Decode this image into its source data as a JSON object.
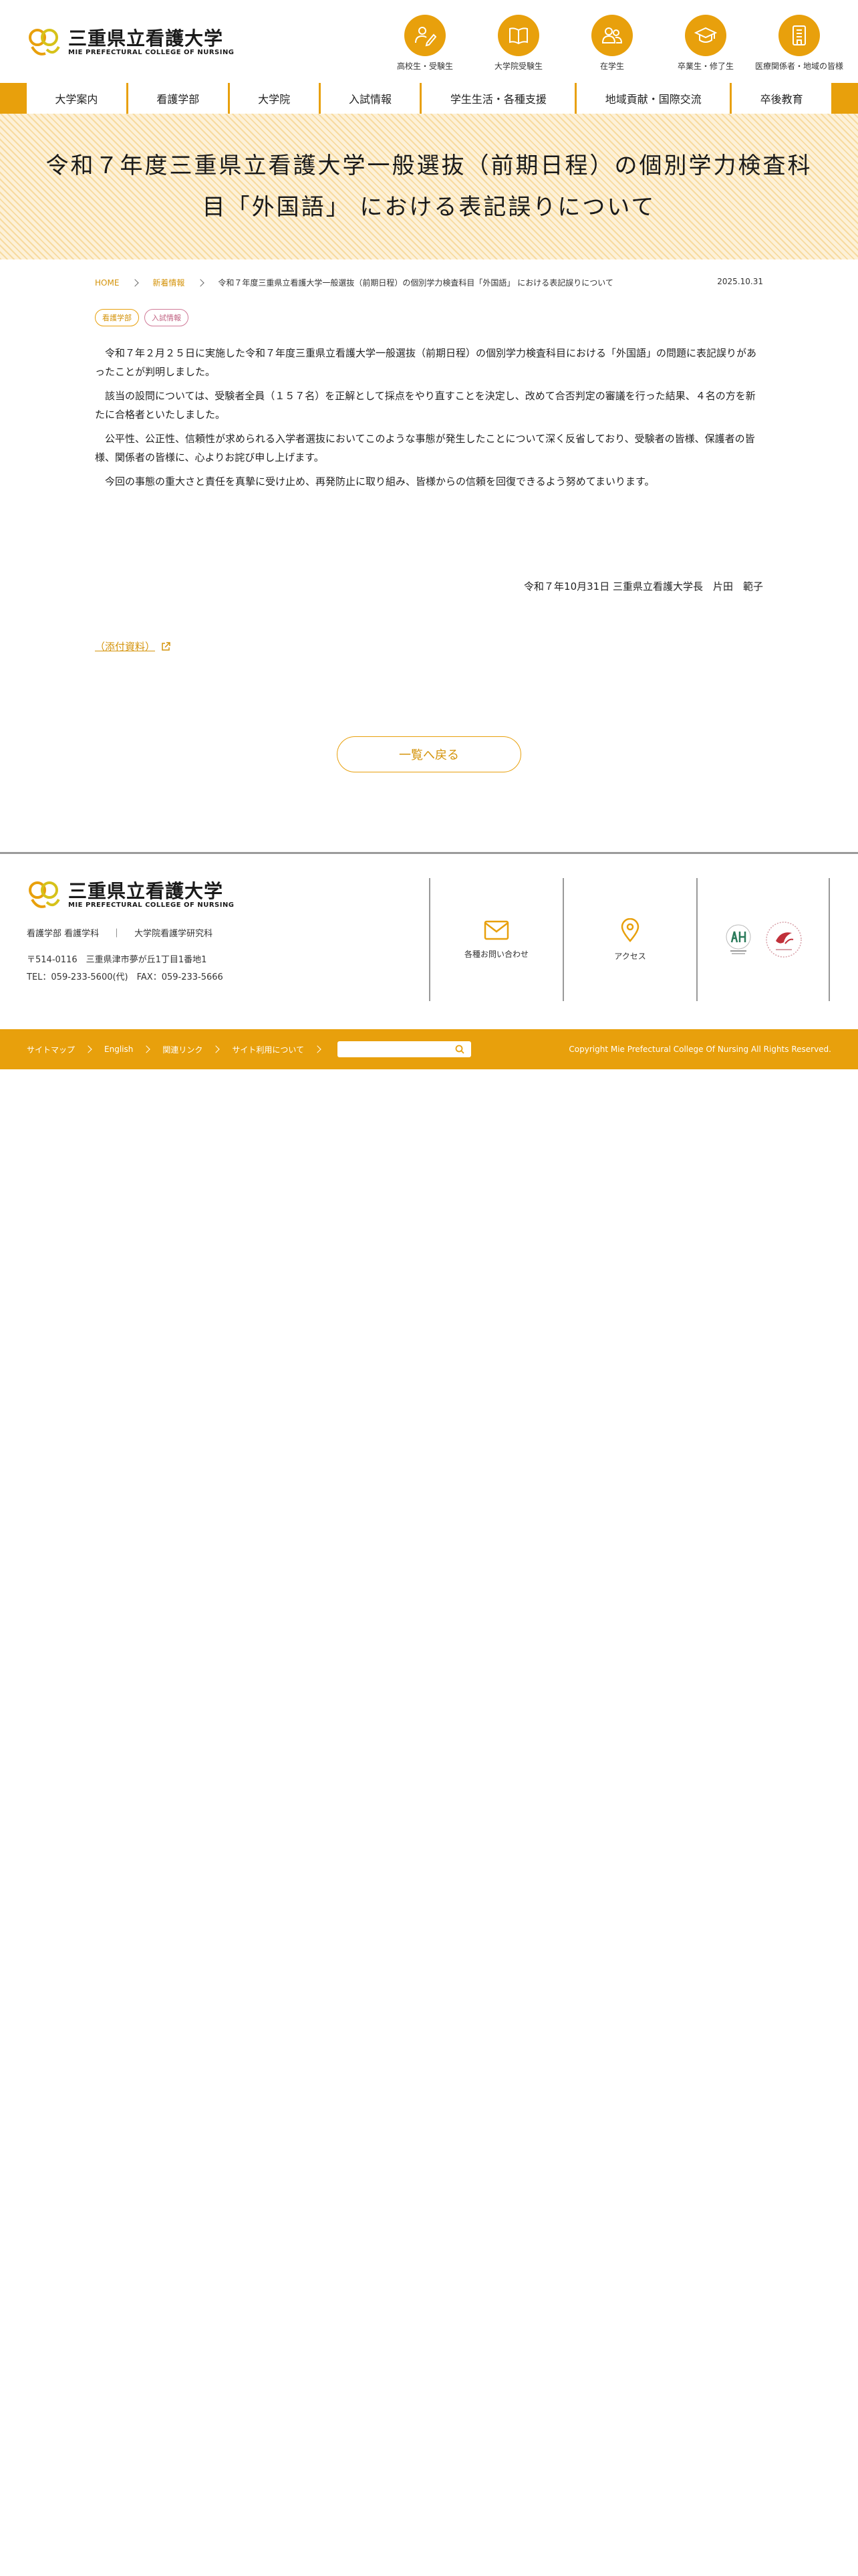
{
  "header": {
    "logo_ja": "三重県立看護大学",
    "logo_en": "MIE PREFECTURAL COLLEGE OF NURSING",
    "quick_links": [
      {
        "label": "高校生・受験生",
        "icon": "pencil-person-icon"
      },
      {
        "label": "大学院受験生",
        "icon": "open-book-icon"
      },
      {
        "label": "在学生",
        "icon": "students-icon"
      },
      {
        "label": "卒業生・修了生",
        "icon": "graduation-cap-icon"
      },
      {
        "label": "医療関係者・地域の皆様",
        "icon": "building-icon"
      }
    ]
  },
  "nav": {
    "items": [
      "大学案内",
      "看護学部",
      "大学院",
      "入試情報",
      "学生生活・各種支援",
      "地域貢献・国際交流",
      "卒後教育"
    ]
  },
  "page": {
    "title": "令和７年度三重県立看護大学一般選抜（前期日程）の個別学力検査科目「外国語」 における表記誤りについて"
  },
  "breadcrumb": {
    "home": "HOME",
    "section": "新着情報",
    "current": "令和７年度三重県立看護大学一般選抜（前期日程）の個別学力検査科目「外国語」 における表記誤りについて"
  },
  "post": {
    "date": "2025.10.31",
    "tags": [
      "看護学部",
      "入試情報"
    ],
    "paragraphs": [
      "令和７年２月２５日に実施した令和７年度三重県立看護大学一般選抜（前期日程）の個別学力検査科目における「外国語」の問題に表記誤りがあったことが判明しました。",
      "該当の設問については、受験者全員（１５７名）を正解として採点をやり直すことを決定し、改めて合否判定の審議を行った結果、４名の方を新たに合格者といたしました。",
      "公平性、公正性、信頼性が求められる入学者選抜においてこのような事態が発生したことについて深く反省しており、受験者の皆様、保護者の皆様、関係者の皆様に、心よりお詫び申し上げます。",
      "今回の事態の重大さと責任を真摯に受け止め、再発防止に取り組み、皆様からの信頼を回復できるよう努めてまいります。"
    ],
    "signature": "令和７年10月31日 三重県立看護大学長　片田　範子",
    "attachment": "（添付資料）",
    "back_label": "一覧へ戻る"
  },
  "footer": {
    "logo_ja": "三重県立看護大学",
    "logo_en": "MIE PREFECTURAL COLLEGE OF NURSING",
    "dept1": "看護学部 看護学科",
    "divider": "｜",
    "dept2": "大学院看護学研究科",
    "postal": "〒514-0116　三重県津市夢が丘1丁目1番地1",
    "tel": "TEL：059-233-5600(代)　FAX：059-233-5666",
    "contact_label": "各種お問い合わせ",
    "access_label": "アクセス"
  },
  "bottom": {
    "links": [
      "サイトマップ",
      "English",
      "関連リンク",
      "サイト利用について"
    ],
    "search_placeholder": "",
    "copyright": "Copyright Mie Prefectural College Of Nursing All Rights Reserved."
  },
  "colors": {
    "accent": "#e8a00c",
    "accent_text": "#d4930a",
    "tag_pink": "#c06080"
  }
}
